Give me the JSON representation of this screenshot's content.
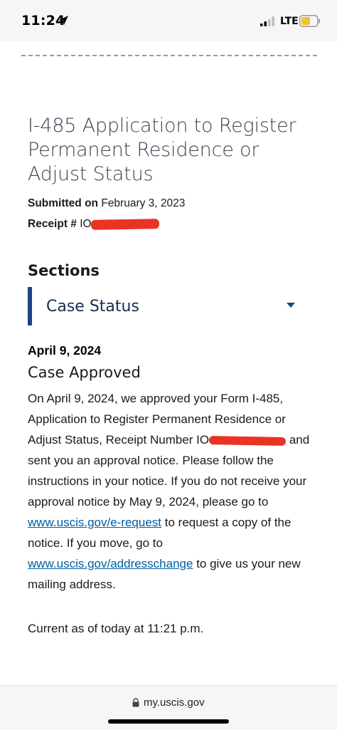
{
  "status_bar": {
    "time": "11:24",
    "network": "LTE",
    "icons": [
      "location-arrow-icon",
      "signal-icon",
      "battery-icon"
    ]
  },
  "case": {
    "title": "I-485 Application to Register Permanent Residence or Adjust Status",
    "submitted_label": "Submitted on",
    "submitted_date": "February 3, 2023",
    "receipt_label": "Receipt #",
    "receipt_visible": "IO"
  },
  "sections": {
    "heading": "Sections",
    "accordion_label": "Case Status"
  },
  "status": {
    "date": "April 9, 2024",
    "title": "Case Approved",
    "p1": "On April 9, 2024, we approved your Form I-485, Application to Register Permanent Residence or Adjust Status, Receipt Number IO",
    "p2": " and sent you an approval notice. Please follow the instructions in your notice. If you do not receive your approval notice by May 9, 2024, please go to ",
    "link1": "www.uscis.gov/e-request",
    "p3": " to request a copy of the notice. If you move, go to ",
    "link2": "www.uscis.gov/addresschange",
    "p4": " to give us your new mailing address."
  },
  "footer": {
    "current": "Current as of today at 11:21 p.m."
  },
  "browser": {
    "url": "my.uscis.gov"
  },
  "colors": {
    "accent": "#1a4480",
    "link": "#005ea2",
    "redaction": "#ea3323"
  }
}
